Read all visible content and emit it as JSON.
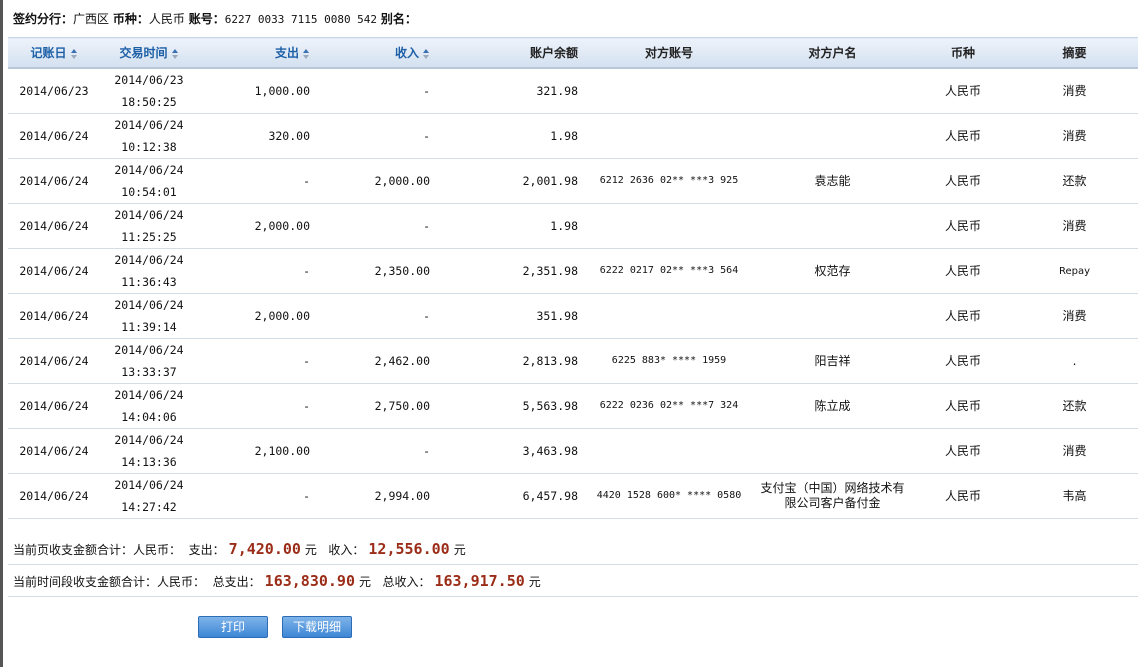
{
  "info": {
    "branch_label": "签约分行：",
    "branch": "广西区",
    "currency_label": "币种：",
    "currency": "人民币",
    "account_label": "账号：",
    "account": "6227 0033 7115 0080 542",
    "alias_label": "别名："
  },
  "columns": [
    "记账日",
    "交易时间",
    "支出",
    "收入",
    "账户余额",
    "对方账号",
    "对方户名",
    "币种",
    "摘要"
  ],
  "rows": [
    {
      "date": "2014/06/23",
      "time_date": "2014/06/23",
      "time": "18:50:25",
      "out": "1,000.00",
      "in": "-",
      "balance": "321.98",
      "acct": "",
      "name": "",
      "cur": "人民币",
      "memo": "消费"
    },
    {
      "date": "2014/06/24",
      "time_date": "2014/06/24",
      "time": "10:12:38",
      "out": "320.00",
      "in": "-",
      "balance": "1.98",
      "acct": "",
      "name": "",
      "cur": "人民币",
      "memo": "消费"
    },
    {
      "date": "2014/06/24",
      "time_date": "2014/06/24",
      "time": "10:54:01",
      "out": "-",
      "in": "2,000.00",
      "balance": "2,001.98",
      "acct": "6212 2636 02** ***3 925",
      "name": "袁志能",
      "cur": "人民币",
      "memo": "还款"
    },
    {
      "date": "2014/06/24",
      "time_date": "2014/06/24",
      "time": "11:25:25",
      "out": "2,000.00",
      "in": "-",
      "balance": "1.98",
      "acct": "",
      "name": "",
      "cur": "人民币",
      "memo": "消费"
    },
    {
      "date": "2014/06/24",
      "time_date": "2014/06/24",
      "time": "11:36:43",
      "out": "-",
      "in": "2,350.00",
      "balance": "2,351.98",
      "acct": "6222 0217 02** ***3 564",
      "name": "权范存",
      "cur": "人民币",
      "memo": "Repay"
    },
    {
      "date": "2014/06/24",
      "time_date": "2014/06/24",
      "time": "11:39:14",
      "out": "2,000.00",
      "in": "-",
      "balance": "351.98",
      "acct": "",
      "name": "",
      "cur": "人民币",
      "memo": "消费"
    },
    {
      "date": "2014/06/24",
      "time_date": "2014/06/24",
      "time": "13:33:37",
      "out": "-",
      "in": "2,462.00",
      "balance": "2,813.98",
      "acct": "6225 883* **** 1959",
      "name": "阳吉祥",
      "cur": "人民币",
      "memo": "."
    },
    {
      "date": "2014/06/24",
      "time_date": "2014/06/24",
      "time": "14:04:06",
      "out": "-",
      "in": "2,750.00",
      "balance": "5,563.98",
      "acct": "6222 0236 02** ***7 324",
      "name": "陈立成",
      "cur": "人民币",
      "memo": "还款"
    },
    {
      "date": "2014/06/24",
      "time_date": "2014/06/24",
      "time": "14:13:36",
      "out": "2,100.00",
      "in": "-",
      "balance": "3,463.98",
      "acct": "",
      "name": "",
      "cur": "人民币",
      "memo": "消费"
    },
    {
      "date": "2014/06/24",
      "time_date": "2014/06/24",
      "time": "14:27:42",
      "out": "-",
      "in": "2,994.00",
      "balance": "6,457.98",
      "acct": "4420 1528 600* **** 0580",
      "name": "支付宝（中国）网络技术有限公司客户备付金",
      "cur": "人民币",
      "memo": "韦高"
    }
  ],
  "page_total": {
    "label": "当前页收支金额合计：人民币：",
    "out_label": "支出：",
    "out": "7,420.00",
    "in_label": "收入：",
    "in": "12,556.00",
    "unit": "元"
  },
  "period_total": {
    "label": "当前时间段收支金额合计：人民币：",
    "out_label": "总支出：",
    "out": "163,830.90",
    "in_label": "总收入：",
    "in": "163,917.50",
    "unit": "元"
  },
  "buttons": {
    "print": "打印",
    "download": "下载明细"
  }
}
